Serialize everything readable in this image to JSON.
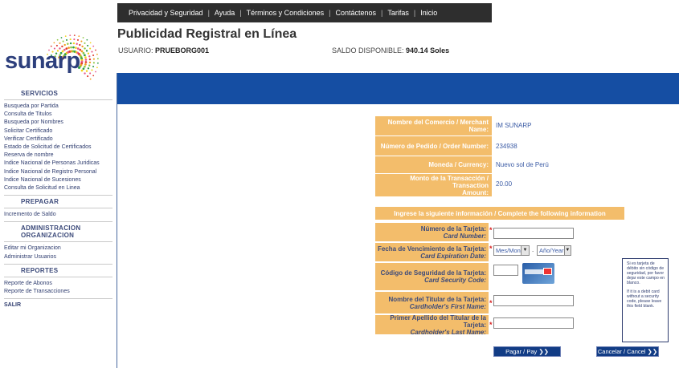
{
  "nav": {
    "items": [
      "Privacidad y Seguridad",
      "Ayuda",
      "Términos y Condiciones",
      "Contáctenos",
      "Tarifas",
      "Inicio"
    ],
    "separator": "|"
  },
  "header": {
    "title": "Publicidad Registral en Línea",
    "user_label": "USUARIO:",
    "user_value": "PRUEBORG001",
    "saldo_label": "SALDO DISPONIBLE:",
    "saldo_value": "940.14 Soles"
  },
  "logo": {
    "text": "sunarp"
  },
  "sidebar": {
    "servicios_heading": "SERVICIOS",
    "servicios": [
      "Busqueda por Partida",
      "Consulta de Titulos",
      "Busqueda por Nombres",
      "Solicitar Certificado",
      "Verificar Certificado",
      "Estado de Solicitud de Certificados",
      "Reserva de nombre",
      "Indice Nacional de Personas Juridicas",
      "Indice Nacional de Registro Personal",
      "Indice Nacional de Sucesiones",
      "Consulta de Solicitud en Linea"
    ],
    "prepagar_heading": "PREPAGAR",
    "prepagar": [
      "Incremento de Saldo"
    ],
    "admin_heading_1": "ADMINISTRACION",
    "admin_heading_2": "ORGANIZACION",
    "admin": [
      "Editar mi Organizacion",
      "Administrar Usuarios"
    ],
    "reportes_heading": "REPORTES",
    "reportes": [
      "Reporte de Abonos",
      "Reporte de Transacciones"
    ],
    "salir": "SALIR"
  },
  "merchant": {
    "rows": [
      {
        "label": "Nombre del Comercio / Merchant Name:",
        "value": "IM SUNARP"
      },
      {
        "label": "Número de Pedido / Order Number:",
        "value": "234938"
      },
      {
        "label": "Moneda / Currency:",
        "value": "Nuevo sol de Perú"
      },
      {
        "label_line1": "Monto de la Transacción / Transaction",
        "label_line2": "Amount:",
        "value": "20.00"
      }
    ]
  },
  "form": {
    "heading": "Ingrese la siguiente información / Complete the following information",
    "card_number": {
      "es": "Número de la Tarjeta:",
      "en": "Card Number:",
      "value": ""
    },
    "expiration": {
      "es": "Fecha de Vencimiento de la Tarjeta:",
      "en": "Card Expiration Date:",
      "month_selected": "Mes/Mon",
      "year_selected": "Año/Year",
      "between": "."
    },
    "security": {
      "es": "Código de Seguridad de la Tarjeta:",
      "en": "Card Security Code:",
      "value": ""
    },
    "first_name": {
      "es": "Nombre del Titular de la Tarjeta:",
      "en": "Cardholder's First Name:",
      "value": ""
    },
    "last_name": {
      "es": "Primer Apellido del Titular de la Tarjeta:",
      "en": "Cardholder's Last Name:",
      "value": ""
    },
    "required_mark": "*",
    "card_image_icon": "credit-card-security-code-icon",
    "note_es": "Si es tarjeta de débito sin código de seguridad, por favor dejar este campo en blanco.",
    "note_en": "If it is a debit card without a security code, please leave this field blank."
  },
  "buttons": {
    "pay": "Pagar / Pay ❯❯",
    "cancel": "Cancelar / Cancel ❯❯"
  },
  "colors": {
    "banner": "#154ea3",
    "label_bg": "#f3bd6b",
    "nav_bg": "#2e2e2e",
    "button_bg": "#123c85"
  }
}
